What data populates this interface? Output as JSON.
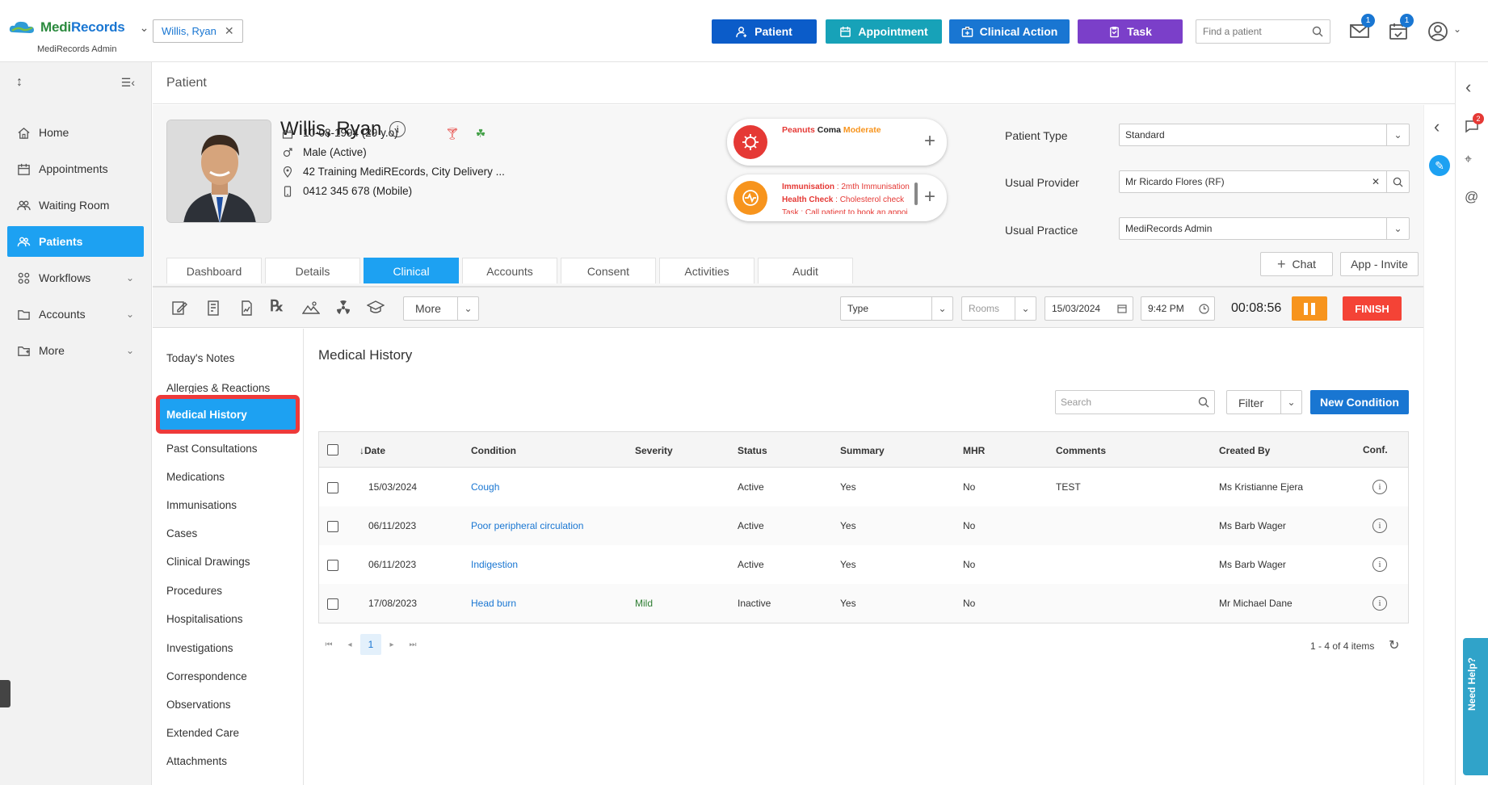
{
  "app": {
    "brand_a": "Medi",
    "brand_b": "Records",
    "subtitle": "MediRecords Admin"
  },
  "patient_chip": "Willis, Ryan",
  "top_buttons": [
    {
      "label": "Patient",
      "color": "#0b5cc9",
      "icon": "add-user-icon"
    },
    {
      "label": "Appointment",
      "color": "#17a2b8",
      "icon": "calendar-icon"
    },
    {
      "label": "Clinical Action",
      "color": "#1976d2",
      "icon": "medical-kit-icon"
    },
    {
      "label": "Task",
      "color": "#7b3fc9",
      "icon": "clipboard-icon"
    }
  ],
  "find_patient_placeholder": "Find a patient",
  "badges": {
    "mail": "1",
    "tasks": "1",
    "messages": "2"
  },
  "sidebar": {
    "items": [
      {
        "label": "Home",
        "icon": "home-icon"
      },
      {
        "label": "Appointments",
        "icon": "calendar-icon"
      },
      {
        "label": "Waiting Room",
        "icon": "people-icon"
      },
      {
        "label": "Patients",
        "icon": "patients-icon"
      },
      {
        "label": "Workflows",
        "icon": "workflow-icon"
      },
      {
        "label": "Accounts",
        "icon": "folder-icon"
      },
      {
        "label": "More",
        "icon": "more-icon"
      }
    ]
  },
  "page_title": "Patient",
  "patient": {
    "name": "Willis, Ryan",
    "dob": "10-08-1994 (29 y.o)",
    "gender": "Male (Active)",
    "address": "42 Training MediREcords, City Delivery ...",
    "phone": "0412 345 678 (Mobile)"
  },
  "alerts": {
    "allergy_name": "Peanuts",
    "allergy_reaction": "Coma",
    "allergy_severity": "Moderate",
    "rem1_label": "Immunisation",
    "rem1_text": " : 2mth Immunisation",
    "rem2_label": "Health Check",
    "rem2_text": " : Cholesterol check",
    "rem3_text": "Task : Call patient to book an appoi"
  },
  "fields": {
    "patient_type_label": "Patient Type",
    "patient_type_value": "Standard",
    "usual_provider_label": "Usual Provider",
    "usual_provider_value": "Mr Ricardo Flores (RF)",
    "usual_practice_label": "Usual Practice",
    "usual_practice_value": "MediRecords Admin"
  },
  "chat_label": "Chat",
  "app_invite_label": "App - Invite",
  "tabs": [
    "Dashboard",
    "Details",
    "Clinical",
    "Accounts",
    "Consent",
    "Activities",
    "Audit"
  ],
  "toolbar": {
    "more_label": "More",
    "type_label": "Type",
    "rooms_label": "Rooms",
    "date": "15/03/2024",
    "time": "9:42 PM",
    "timer": "00:08:56",
    "finish_label": "FINISH"
  },
  "left_menu": [
    "Today's Notes",
    "Allergies & Reactions",
    "Medical History",
    "Past Consultations",
    "Medications",
    "Immunisations",
    "Cases",
    "Clinical Drawings",
    "Procedures",
    "Hospitalisations",
    "Investigations",
    "Correspondence",
    "Observations",
    "Extended Care",
    "Attachments"
  ],
  "content": {
    "title": "Medical History",
    "search_placeholder": "Search",
    "filter_label": "Filter",
    "new_condition_label": "New Condition"
  },
  "table": {
    "headers": [
      "Date",
      "Condition",
      "Severity",
      "Status",
      "Summary",
      "MHR",
      "Comments",
      "Created By",
      "Conf."
    ],
    "rows": [
      {
        "date": "15/03/2024",
        "condition": "Cough",
        "severity": "",
        "status": "Active",
        "summary": "Yes",
        "mhr": "No",
        "comments": "TEST",
        "created_by": "Ms Kristianne Ejera"
      },
      {
        "date": "06/11/2023",
        "condition": "Poor peripheral circulation",
        "severity": "",
        "status": "Active",
        "summary": "Yes",
        "mhr": "No",
        "comments": "",
        "created_by": "Ms Barb Wager"
      },
      {
        "date": "06/11/2023",
        "condition": "Indigestion",
        "severity": "",
        "status": "Active",
        "summary": "Yes",
        "mhr": "No",
        "comments": "",
        "created_by": "Ms Barb Wager"
      },
      {
        "date": "17/08/2023",
        "condition": "Head burn",
        "severity": "Mild",
        "status": "Inactive",
        "summary": "Yes",
        "mhr": "No",
        "comments": "",
        "created_by": "Mr Michael Dane"
      }
    ]
  },
  "pager": {
    "page": "1",
    "items_text": "1 - 4 of 4 items"
  },
  "need_help": "Need Help?"
}
